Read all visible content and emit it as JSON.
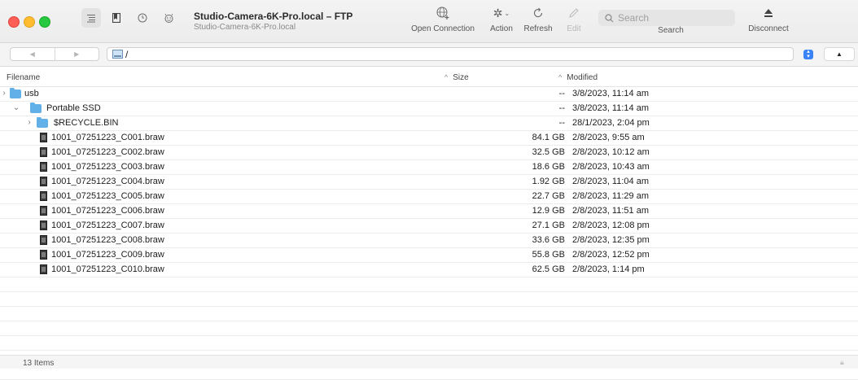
{
  "window": {
    "title": "Studio-Camera-6K-Pro.local – FTP",
    "subtitle": "Studio-Camera-6K-Pro.local"
  },
  "toolbar": {
    "open_connection": "Open Connection",
    "action": "Action",
    "refresh": "Refresh",
    "edit": "Edit",
    "search_label": "Search",
    "search_placeholder": "Search",
    "disconnect": "Disconnect"
  },
  "path": {
    "current": "/"
  },
  "columns": {
    "filename": "Filename",
    "size": "Size",
    "modified": "Modified"
  },
  "rows": [
    {
      "name": "usb",
      "type": "folder",
      "disclosure": "collapsed",
      "level": 0,
      "size": "--",
      "modified": "3/8/2023, 11:14 am"
    },
    {
      "name": "Portable SSD",
      "type": "folder",
      "disclosure": "expanded",
      "level": 1,
      "size": "--",
      "modified": "3/8/2023, 11:14 am"
    },
    {
      "name": "$RECYCLE.BIN",
      "type": "folder",
      "disclosure": "collapsed",
      "level": 2,
      "size": "--",
      "modified": "28/1/2023, 2:04 pm"
    },
    {
      "name": "1001_07251223_C001.braw",
      "type": "file",
      "level": 2,
      "size": "84.1 GB",
      "modified": "2/8/2023, 9:55 am"
    },
    {
      "name": "1001_07251223_C002.braw",
      "type": "file",
      "level": 2,
      "size": "32.5 GB",
      "modified": "2/8/2023, 10:12 am"
    },
    {
      "name": "1001_07251223_C003.braw",
      "type": "file",
      "level": 2,
      "size": "18.6 GB",
      "modified": "2/8/2023, 10:43 am"
    },
    {
      "name": "1001_07251223_C004.braw",
      "type": "file",
      "level": 2,
      "size": "1.92 GB",
      "modified": "2/8/2023, 11:04 am"
    },
    {
      "name": "1001_07251223_C005.braw",
      "type": "file",
      "level": 2,
      "size": "22.7 GB",
      "modified": "2/8/2023, 11:29 am"
    },
    {
      "name": "1001_07251223_C006.braw",
      "type": "file",
      "level": 2,
      "size": "12.9 GB",
      "modified": "2/8/2023, 11:51 am"
    },
    {
      "name": "1001_07251223_C007.braw",
      "type": "file",
      "level": 2,
      "size": "27.1 GB",
      "modified": "2/8/2023, 12:08 pm"
    },
    {
      "name": "1001_07251223_C008.braw",
      "type": "file",
      "level": 2,
      "size": "33.6 GB",
      "modified": "2/8/2023, 12:35 pm"
    },
    {
      "name": "1001_07251223_C009.braw",
      "type": "file",
      "level": 2,
      "size": "55.8 GB",
      "modified": "2/8/2023, 12:52 pm"
    },
    {
      "name": "1001_07251223_C010.braw",
      "type": "file",
      "level": 2,
      "size": "62.5 GB",
      "modified": "2/8/2023, 1:14 pm"
    }
  ],
  "status": {
    "item_count": "13 Items"
  },
  "colors": {
    "folder": "#62b0e8",
    "close": "#fe5f57",
    "minimize": "#febc2e",
    "zoom": "#28c840"
  }
}
